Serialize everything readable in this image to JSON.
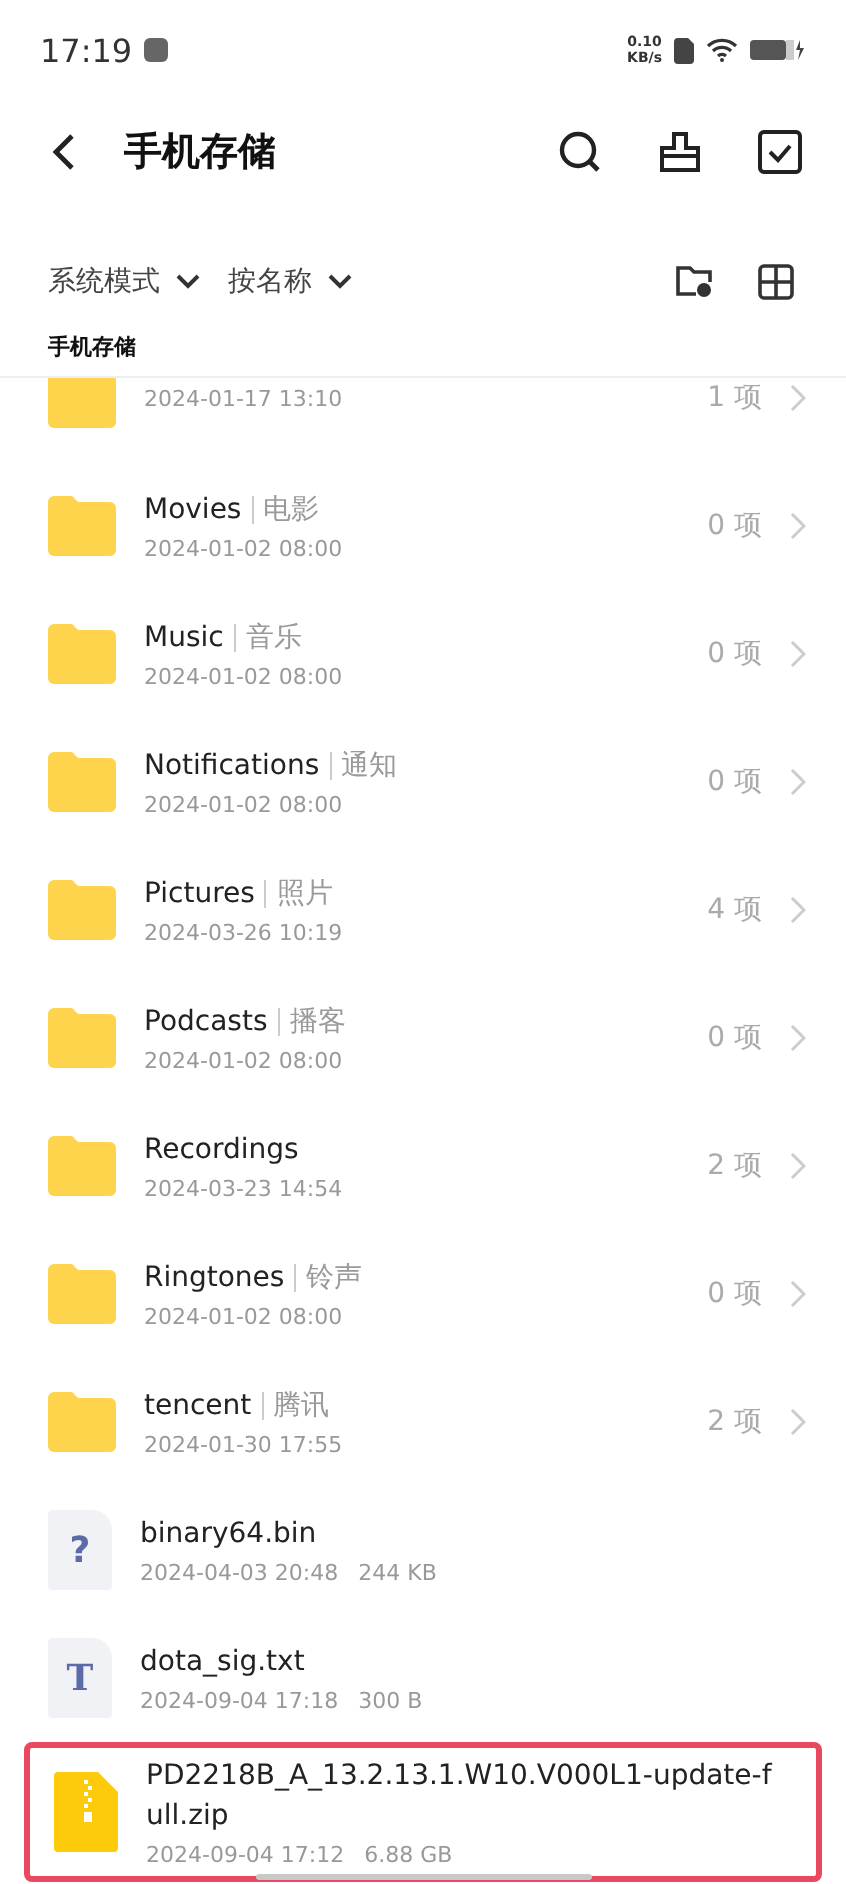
{
  "status_bar": {
    "time": "17:19",
    "net_speed": "0.10",
    "net_unit": "KB/s"
  },
  "header": {
    "title": "手机存储"
  },
  "toolbar": {
    "view_mode": "系统模式",
    "sort": "按名称"
  },
  "breadcrumb": "手机存储",
  "files": [
    {
      "kind": "folder",
      "date": "2024-01-17 13:10",
      "count": "1 项",
      "selected": false
    },
    {
      "kind": "folder",
      "name": "Movies",
      "alias": "电影",
      "date": "2024-01-02 08:00",
      "count": "0 项",
      "selected": false
    },
    {
      "kind": "folder",
      "name": "Music",
      "alias": "音乐",
      "date": "2024-01-02 08:00",
      "count": "0 项",
      "selected": false
    },
    {
      "kind": "folder",
      "name": "Notifications",
      "alias": "通知",
      "date": "2024-01-02 08:00",
      "count": "0 项",
      "selected": false
    },
    {
      "kind": "folder",
      "name": "Pictures",
      "alias": "照片",
      "date": "2024-03-26 10:19",
      "count": "4 项",
      "selected": false
    },
    {
      "kind": "folder",
      "name": "Podcasts",
      "alias": "播客",
      "date": "2024-01-02 08:00",
      "count": "0 项",
      "selected": false
    },
    {
      "kind": "folder",
      "name": "Recordings",
      "date": "2024-03-23 14:54",
      "count": "2 项",
      "selected": false
    },
    {
      "kind": "folder",
      "name": "Ringtones",
      "alias": "铃声",
      "date": "2024-01-02 08:00",
      "count": "0 项",
      "selected": false
    },
    {
      "kind": "folder",
      "name": "tencent",
      "alias": "腾讯",
      "date": "2024-01-30 17:55",
      "count": "2 项",
      "selected": false
    },
    {
      "kind": "unknown",
      "icon_glyph": "?",
      "name": "binary64.bin",
      "date": "2024-04-03 20:48",
      "size": "244 KB",
      "selected": false
    },
    {
      "kind": "text",
      "icon_glyph": "T",
      "name": "dota_sig.txt",
      "date": "2024-09-04 17:18",
      "size": "300 B",
      "selected": false
    },
    {
      "kind": "zip",
      "name": "PD2218B_A_13.2.13.1.W10.V000L1-update-full.zip",
      "date": "2024-09-04 17:12",
      "size": "6.88 GB",
      "selected": true
    }
  ]
}
